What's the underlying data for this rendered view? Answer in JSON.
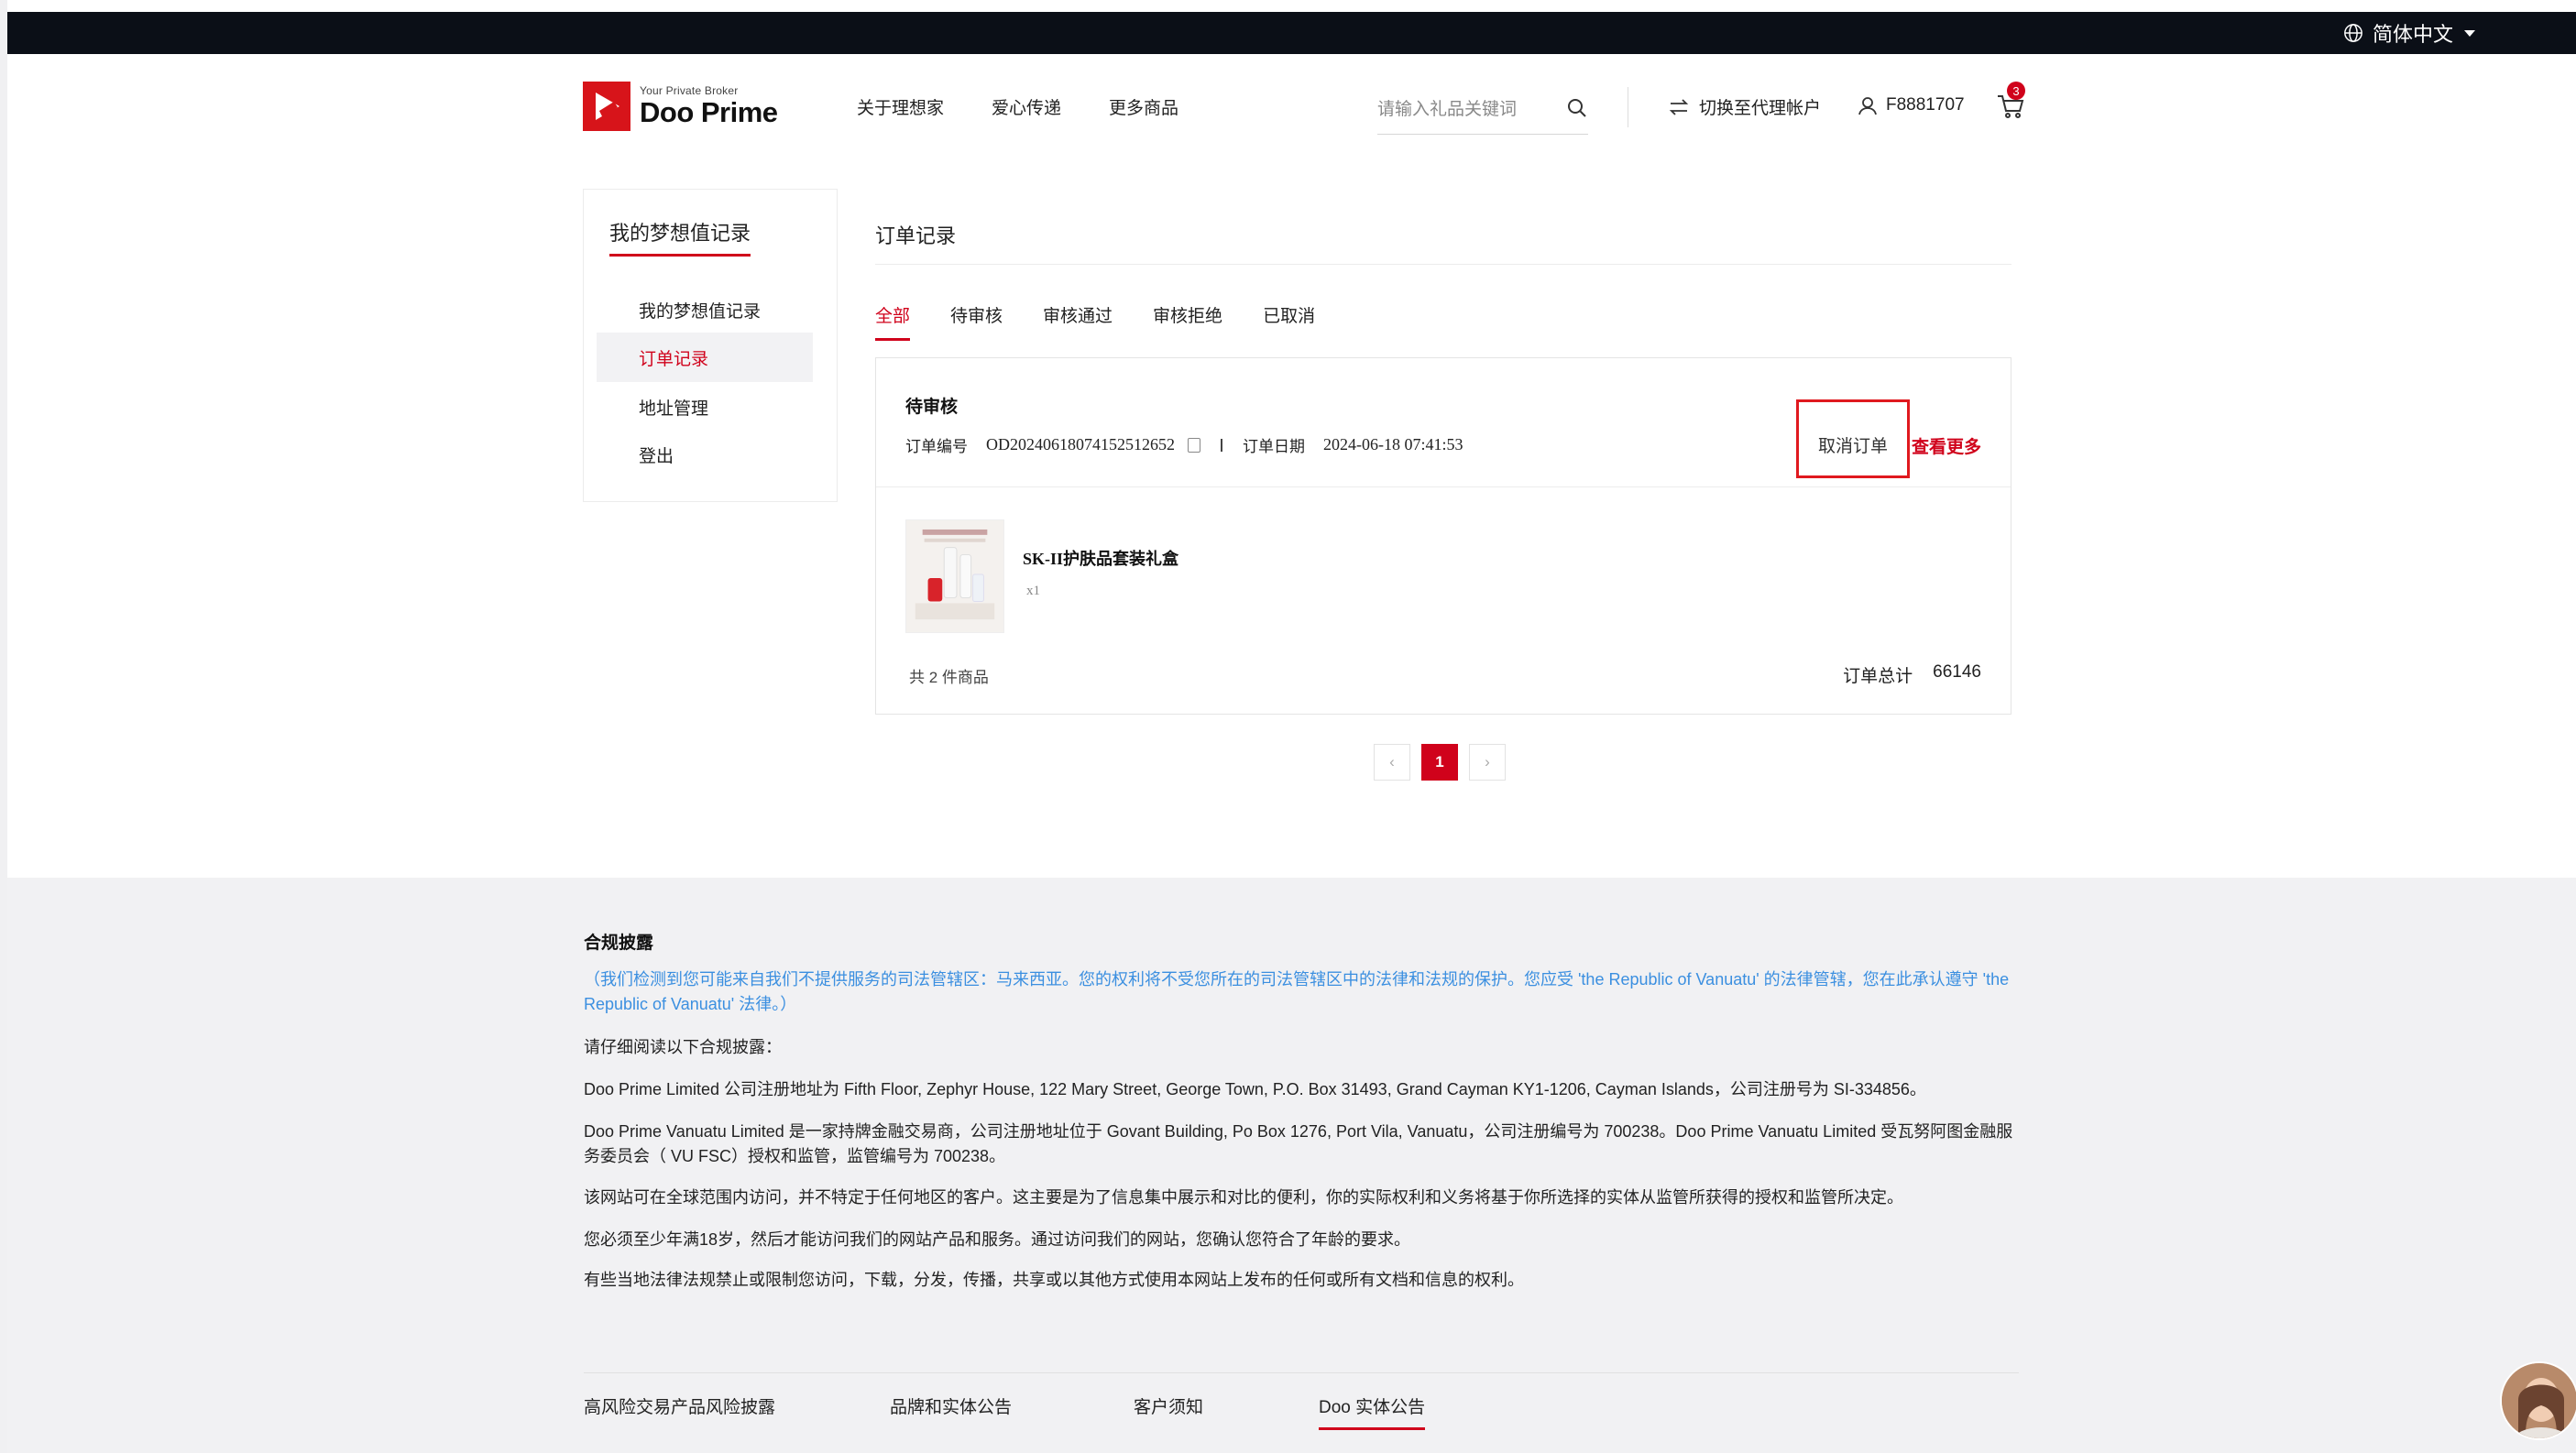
{
  "topbar": {
    "language": "简体中文"
  },
  "header": {
    "logo_tagline": "Your Private Broker",
    "logo_name": "Doo Prime",
    "nav": [
      "关于理想家",
      "爱心传递",
      "更多商品"
    ],
    "search_placeholder": "请输入礼品关键词",
    "switch_label": "切换至代理帐户",
    "user_id": "F8881707",
    "cart_count": "3"
  },
  "sidebar": {
    "title": "我的梦想值记录",
    "items": [
      "我的梦想值记录",
      "订单记录",
      "地址管理",
      "登出"
    ],
    "active_index": 1
  },
  "main": {
    "title": "订单记录",
    "tabs": [
      "全部",
      "待审核",
      "审核通过",
      "审核拒绝",
      "已取消"
    ],
    "active_tab": 0,
    "order": {
      "status": "待审核",
      "number_label": "订单编号",
      "number": "OD20240618074152512652",
      "date_label": "订单日期",
      "date": "2024-06-18 07:41:53",
      "cancel_label": "取消订单",
      "more_label": "查看更多",
      "product_name": "SK-II护肤品套装礼盒",
      "product_qty": "x1",
      "item_count": "共 2 件商品",
      "total_label": "订单总计",
      "total_value": "66146"
    },
    "pagination": {
      "prev": "‹",
      "current": "1",
      "next": "›"
    }
  },
  "footer": {
    "title": "合规披露",
    "notice": "（我们检测到您可能来自我们不提供服务的司法管辖区：马来西亚。您的权利将不受您所在的司法管辖区中的法律和法规的保护。您应受 'the Republic of Vanuatu' 的法律管辖，您在此承认遵守 'the Republic of Vanuatu' 法律。）",
    "paragraphs": [
      "请仔细阅读以下合规披露：",
      "Doo Prime Limited 公司注册地址为 Fifth Floor, Zephyr House, 122 Mary Street, George Town, P.O. Box 31493, Grand Cayman KY1-1206, Cayman Islands，公司注册号为 SI-334856。",
      "Doo Prime Vanuatu Limited 是一家持牌金融交易商，公司注册地址位于 Govant Building, Po Box 1276, Port Vila, Vanuatu，公司注册编号为 700238。Doo Prime Vanuatu Limited 受瓦努阿图金融服务委员会（ VU FSC）授权和监管，监管编号为 700238。",
      "该网站可在全球范围内访问，并不特定于任何地区的客户。这主要是为了信息集中展示和对比的便利，你的实际权利和义务将基于你所选择的实体从监管所获得的授权和监管所决定。",
      "您必须至少年满18岁，然后才能访问我们的网站产品和服务。通过访问我们的网站，您确认您符合了年龄的要求。",
      "有些当地法律法规禁止或限制您访问，下载，分发，传播，共享或以其他方式使用本网站上发布的任何或所有文档和信息的权利。"
    ],
    "links": [
      "高风险交易产品风险披露",
      "品牌和实体公告",
      "客户须知",
      "Doo 实体公告"
    ],
    "active_link": 3
  },
  "colors": {
    "brand_red": "#d0021b",
    "notice_blue": "#3b8fe0",
    "highlight_box": "#e0191f"
  }
}
